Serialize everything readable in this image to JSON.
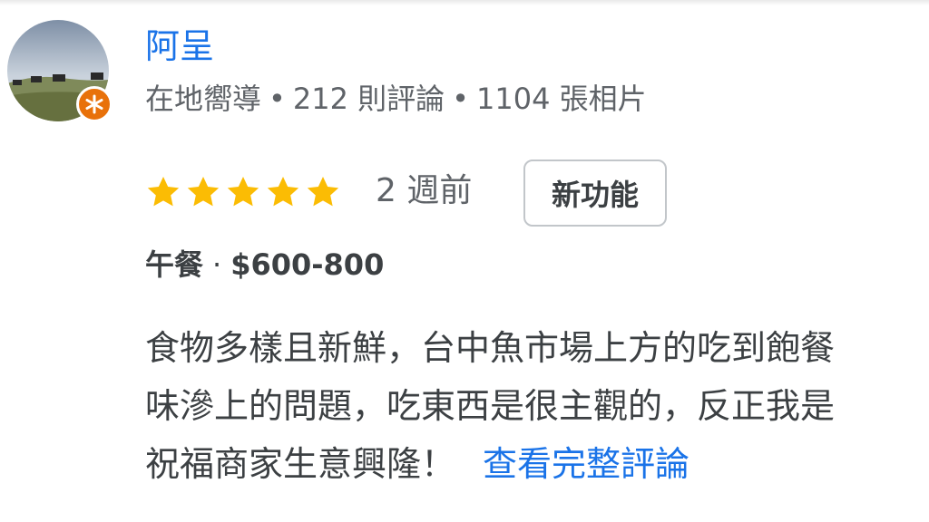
{
  "reviewer": {
    "name": "阿呈",
    "level": "在地嚮導",
    "reviews": "212 則評論",
    "photos": "1104 張相片",
    "avatar_icon": "cows-on-hill-photo",
    "badge_icon": "local-guide-star-icon",
    "badge_color": "#e8710a"
  },
  "rating": {
    "stars": 5,
    "max_stars": 5,
    "star_color": "#fbbc04",
    "time": "2 週前",
    "new_badge": "新功能"
  },
  "meal": {
    "type": "午餐",
    "price": "$600-800"
  },
  "review": {
    "lines": [
      "食物多樣且新鮮，台中魚市場上方的吃到飽餐",
      "味滲上的問題，吃東西是很主觀的，反正我是",
      "祝福商家生意興隆！"
    ],
    "more_link": "查看完整評論"
  },
  "colors": {
    "link": "#1a73e8",
    "meta_text": "#5f6368",
    "body_text": "#3c4043"
  }
}
